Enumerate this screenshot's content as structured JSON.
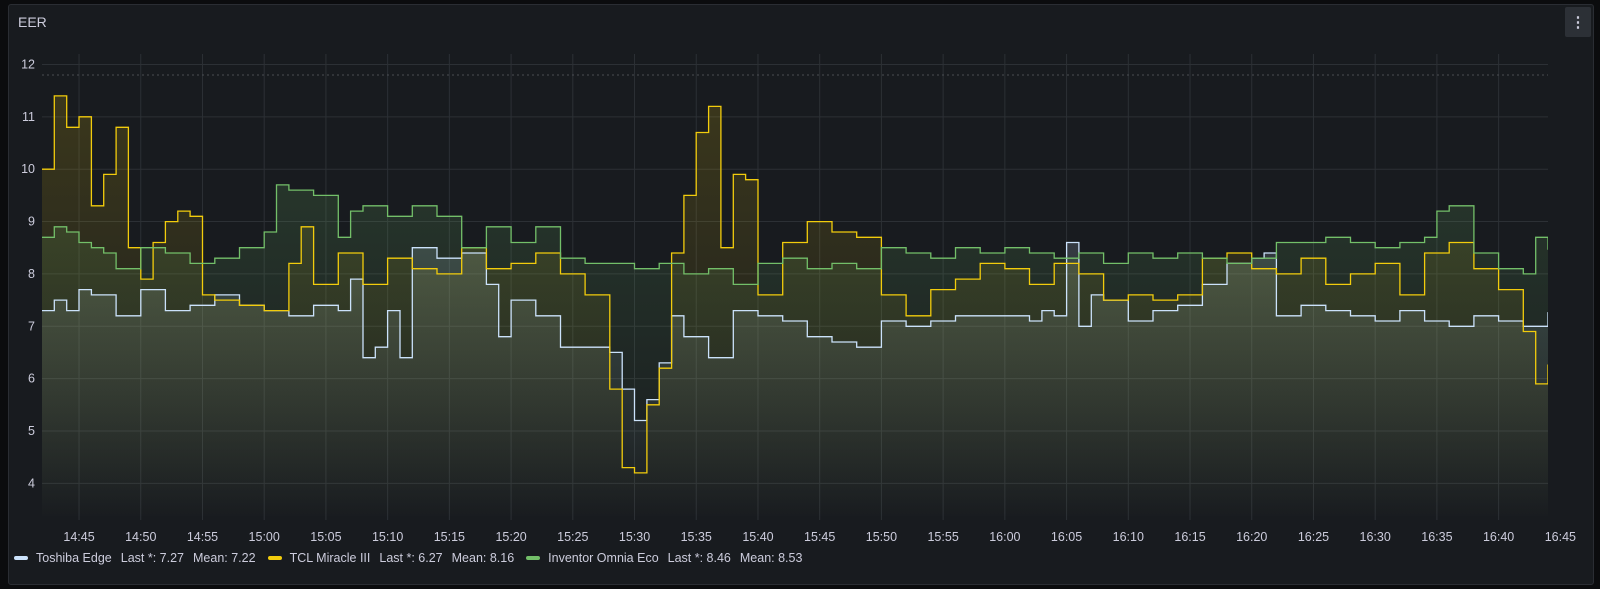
{
  "panel": {
    "title": "EER",
    "menu_icon": "⋮"
  },
  "colors": {
    "background": "#181b1f",
    "grid": "#2c3035",
    "text": "#ccccdc"
  },
  "legend": [
    {
      "name": "Toshiba Edge",
      "color": "#cbe2fb",
      "last": "Last *: 7.27",
      "mean": "Mean: 7.22"
    },
    {
      "name": "TCL Miracle III",
      "color": "#f2cc0c",
      "last": "Last *: 6.27",
      "mean": "Mean: 8.16"
    },
    {
      "name": "Inventor Omnia Eco",
      "color": "#73bf69",
      "last": "Last *: 8.46",
      "mean": "Mean: 8.53"
    }
  ],
  "chart_data": {
    "type": "line",
    "x_unit": "minutes",
    "xlim": [
      "14:42",
      "16:44"
    ],
    "ylim": [
      3.3,
      12.2
    ],
    "yticks": [
      4,
      5,
      6,
      7,
      8,
      9,
      10,
      11,
      12
    ],
    "xticks": [
      "14:45",
      "14:50",
      "14:55",
      "15:00",
      "15:05",
      "15:10",
      "15:15",
      "15:20",
      "15:25",
      "15:30",
      "15:35",
      "15:40",
      "15:45",
      "15:50",
      "15:55",
      "16:00",
      "16:05",
      "16:10",
      "16:15",
      "16:20",
      "16:25",
      "16:30",
      "16:35",
      "16:40",
      "16:45"
    ],
    "threshold": 11.8,
    "grid": true,
    "legend_position": "bottom",
    "series": [
      {
        "name": "Toshiba Edge",
        "color": "#cbe2fb",
        "x": [
          "14:42",
          "14:43",
          "14:44",
          "14:45",
          "14:46",
          "14:48",
          "14:50",
          "14:52",
          "14:54",
          "14:56",
          "14:58",
          "15:00",
          "15:02",
          "15:04",
          "15:06",
          "15:07",
          "15:08",
          "15:09",
          "15:10",
          "15:11",
          "15:12",
          "15:14",
          "15:16",
          "15:18",
          "15:19",
          "15:20",
          "15:22",
          "15:24",
          "15:26",
          "15:28",
          "15:29",
          "15:30",
          "15:31",
          "15:32",
          "15:33",
          "15:34",
          "15:35",
          "15:36",
          "15:38",
          "15:40",
          "15:42",
          "15:44",
          "15:46",
          "15:48",
          "15:50",
          "15:52",
          "15:54",
          "15:56",
          "15:58",
          "16:00",
          "16:02",
          "16:03",
          "16:04",
          "16:05",
          "16:06",
          "16:07",
          "16:08",
          "16:10",
          "16:12",
          "16:14",
          "16:16",
          "16:18",
          "16:20",
          "16:21",
          "16:22",
          "16:24",
          "16:26",
          "16:28",
          "16:30",
          "16:32",
          "16:34",
          "16:36",
          "16:38",
          "16:40",
          "16:42",
          "16:44"
        ],
        "y": [
          7.3,
          7.5,
          7.3,
          7.7,
          7.6,
          7.2,
          7.7,
          7.3,
          7.4,
          7.6,
          7.4,
          7.3,
          7.2,
          7.4,
          7.3,
          7.9,
          6.4,
          6.6,
          7.3,
          6.4,
          8.5,
          8.3,
          8.4,
          7.8,
          6.8,
          7.5,
          7.2,
          6.6,
          6.6,
          6.5,
          5.8,
          5.2,
          5.6,
          6.3,
          7.2,
          6.8,
          6.8,
          6.4,
          7.3,
          7.2,
          7.1,
          6.8,
          6.7,
          6.6,
          7.1,
          7.0,
          7.1,
          7.2,
          7.2,
          7.2,
          7.1,
          7.3,
          7.2,
          8.6,
          7.0,
          7.6,
          7.5,
          7.1,
          7.3,
          7.4,
          7.8,
          8.2,
          8.3,
          8.4,
          7.2,
          7.4,
          7.3,
          7.2,
          7.1,
          7.3,
          7.1,
          7.0,
          7.2,
          7.1,
          7.0,
          7.27
        ]
      },
      {
        "name": "TCL Miracle III",
        "color": "#f2cc0c",
        "x": [
          "14:42",
          "14:43",
          "14:44",
          "14:45",
          "14:46",
          "14:47",
          "14:48",
          "14:49",
          "14:50",
          "14:51",
          "14:52",
          "14:53",
          "14:54",
          "14:55",
          "14:56",
          "14:58",
          "15:00",
          "15:02",
          "15:03",
          "15:04",
          "15:06",
          "15:08",
          "15:10",
          "15:12",
          "15:14",
          "15:16",
          "15:18",
          "15:20",
          "15:22",
          "15:24",
          "15:26",
          "15:28",
          "15:29",
          "15:30",
          "15:31",
          "15:32",
          "15:33",
          "15:34",
          "15:35",
          "15:36",
          "15:37",
          "15:38",
          "15:39",
          "15:40",
          "15:42",
          "15:44",
          "15:46",
          "15:48",
          "15:50",
          "15:52",
          "15:54",
          "15:56",
          "15:58",
          "16:00",
          "16:02",
          "16:04",
          "16:06",
          "16:08",
          "16:10",
          "16:12",
          "16:14",
          "16:16",
          "16:18",
          "16:20",
          "16:22",
          "16:24",
          "16:26",
          "16:28",
          "16:30",
          "16:32",
          "16:34",
          "16:36",
          "16:38",
          "16:40",
          "16:42",
          "16:43",
          "16:44"
        ],
        "y": [
          10.0,
          11.4,
          10.8,
          11.0,
          9.3,
          9.9,
          10.8,
          8.5,
          7.9,
          8.6,
          9.0,
          9.2,
          9.1,
          7.6,
          7.5,
          7.4,
          7.3,
          8.2,
          8.9,
          7.8,
          8.4,
          7.8,
          8.3,
          8.1,
          8.0,
          8.5,
          8.1,
          8.2,
          8.4,
          8.0,
          7.6,
          5.8,
          4.3,
          4.2,
          5.5,
          6.2,
          8.4,
          9.5,
          10.7,
          11.2,
          8.5,
          9.9,
          9.8,
          7.6,
          8.6,
          9.0,
          8.8,
          8.7,
          7.6,
          7.2,
          7.7,
          7.9,
          8.2,
          8.1,
          7.8,
          8.2,
          8.0,
          7.5,
          7.6,
          7.5,
          7.6,
          8.3,
          8.4,
          8.1,
          8.0,
          8.3,
          7.8,
          8.0,
          8.2,
          7.6,
          8.4,
          8.6,
          8.1,
          7.7,
          6.9,
          5.9,
          6.27
        ]
      },
      {
        "name": "Inventor Omnia Eco",
        "color": "#73bf69",
        "x": [
          "14:42",
          "14:43",
          "14:44",
          "14:45",
          "14:46",
          "14:47",
          "14:48",
          "14:50",
          "14:52",
          "14:54",
          "14:56",
          "14:58",
          "15:00",
          "15:01",
          "15:02",
          "15:04",
          "15:06",
          "15:07",
          "15:08",
          "15:10",
          "15:12",
          "15:14",
          "15:16",
          "15:18",
          "15:20",
          "15:22",
          "15:24",
          "15:26",
          "15:28",
          "15:30",
          "15:32",
          "15:34",
          "15:36",
          "15:38",
          "15:40",
          "15:42",
          "15:44",
          "15:46",
          "15:48",
          "15:50",
          "15:52",
          "15:54",
          "15:56",
          "15:58",
          "16:00",
          "16:02",
          "16:04",
          "16:06",
          "16:08",
          "16:10",
          "16:12",
          "16:14",
          "16:16",
          "16:18",
          "16:20",
          "16:22",
          "16:24",
          "16:26",
          "16:28",
          "16:30",
          "16:32",
          "16:34",
          "16:35",
          "16:36",
          "16:38",
          "16:40",
          "16:42",
          "16:43",
          "16:44"
        ],
        "y": [
          8.7,
          8.9,
          8.8,
          8.6,
          8.5,
          8.4,
          8.1,
          8.5,
          8.4,
          8.2,
          8.3,
          8.5,
          8.8,
          9.7,
          9.6,
          9.5,
          8.7,
          9.2,
          9.3,
          9.1,
          9.3,
          9.1,
          8.5,
          8.9,
          8.6,
          8.9,
          8.3,
          8.2,
          8.2,
          8.1,
          8.2,
          8.0,
          8.1,
          7.8,
          8.2,
          8.3,
          8.1,
          8.2,
          8.1,
          8.5,
          8.4,
          8.3,
          8.5,
          8.4,
          8.5,
          8.4,
          8.3,
          8.4,
          8.2,
          8.4,
          8.3,
          8.4,
          8.3,
          8.2,
          8.3,
          8.6,
          8.6,
          8.7,
          8.6,
          8.5,
          8.6,
          8.7,
          9.2,
          9.3,
          8.4,
          8.1,
          8.0,
          8.7,
          8.46
        ]
      }
    ]
  }
}
